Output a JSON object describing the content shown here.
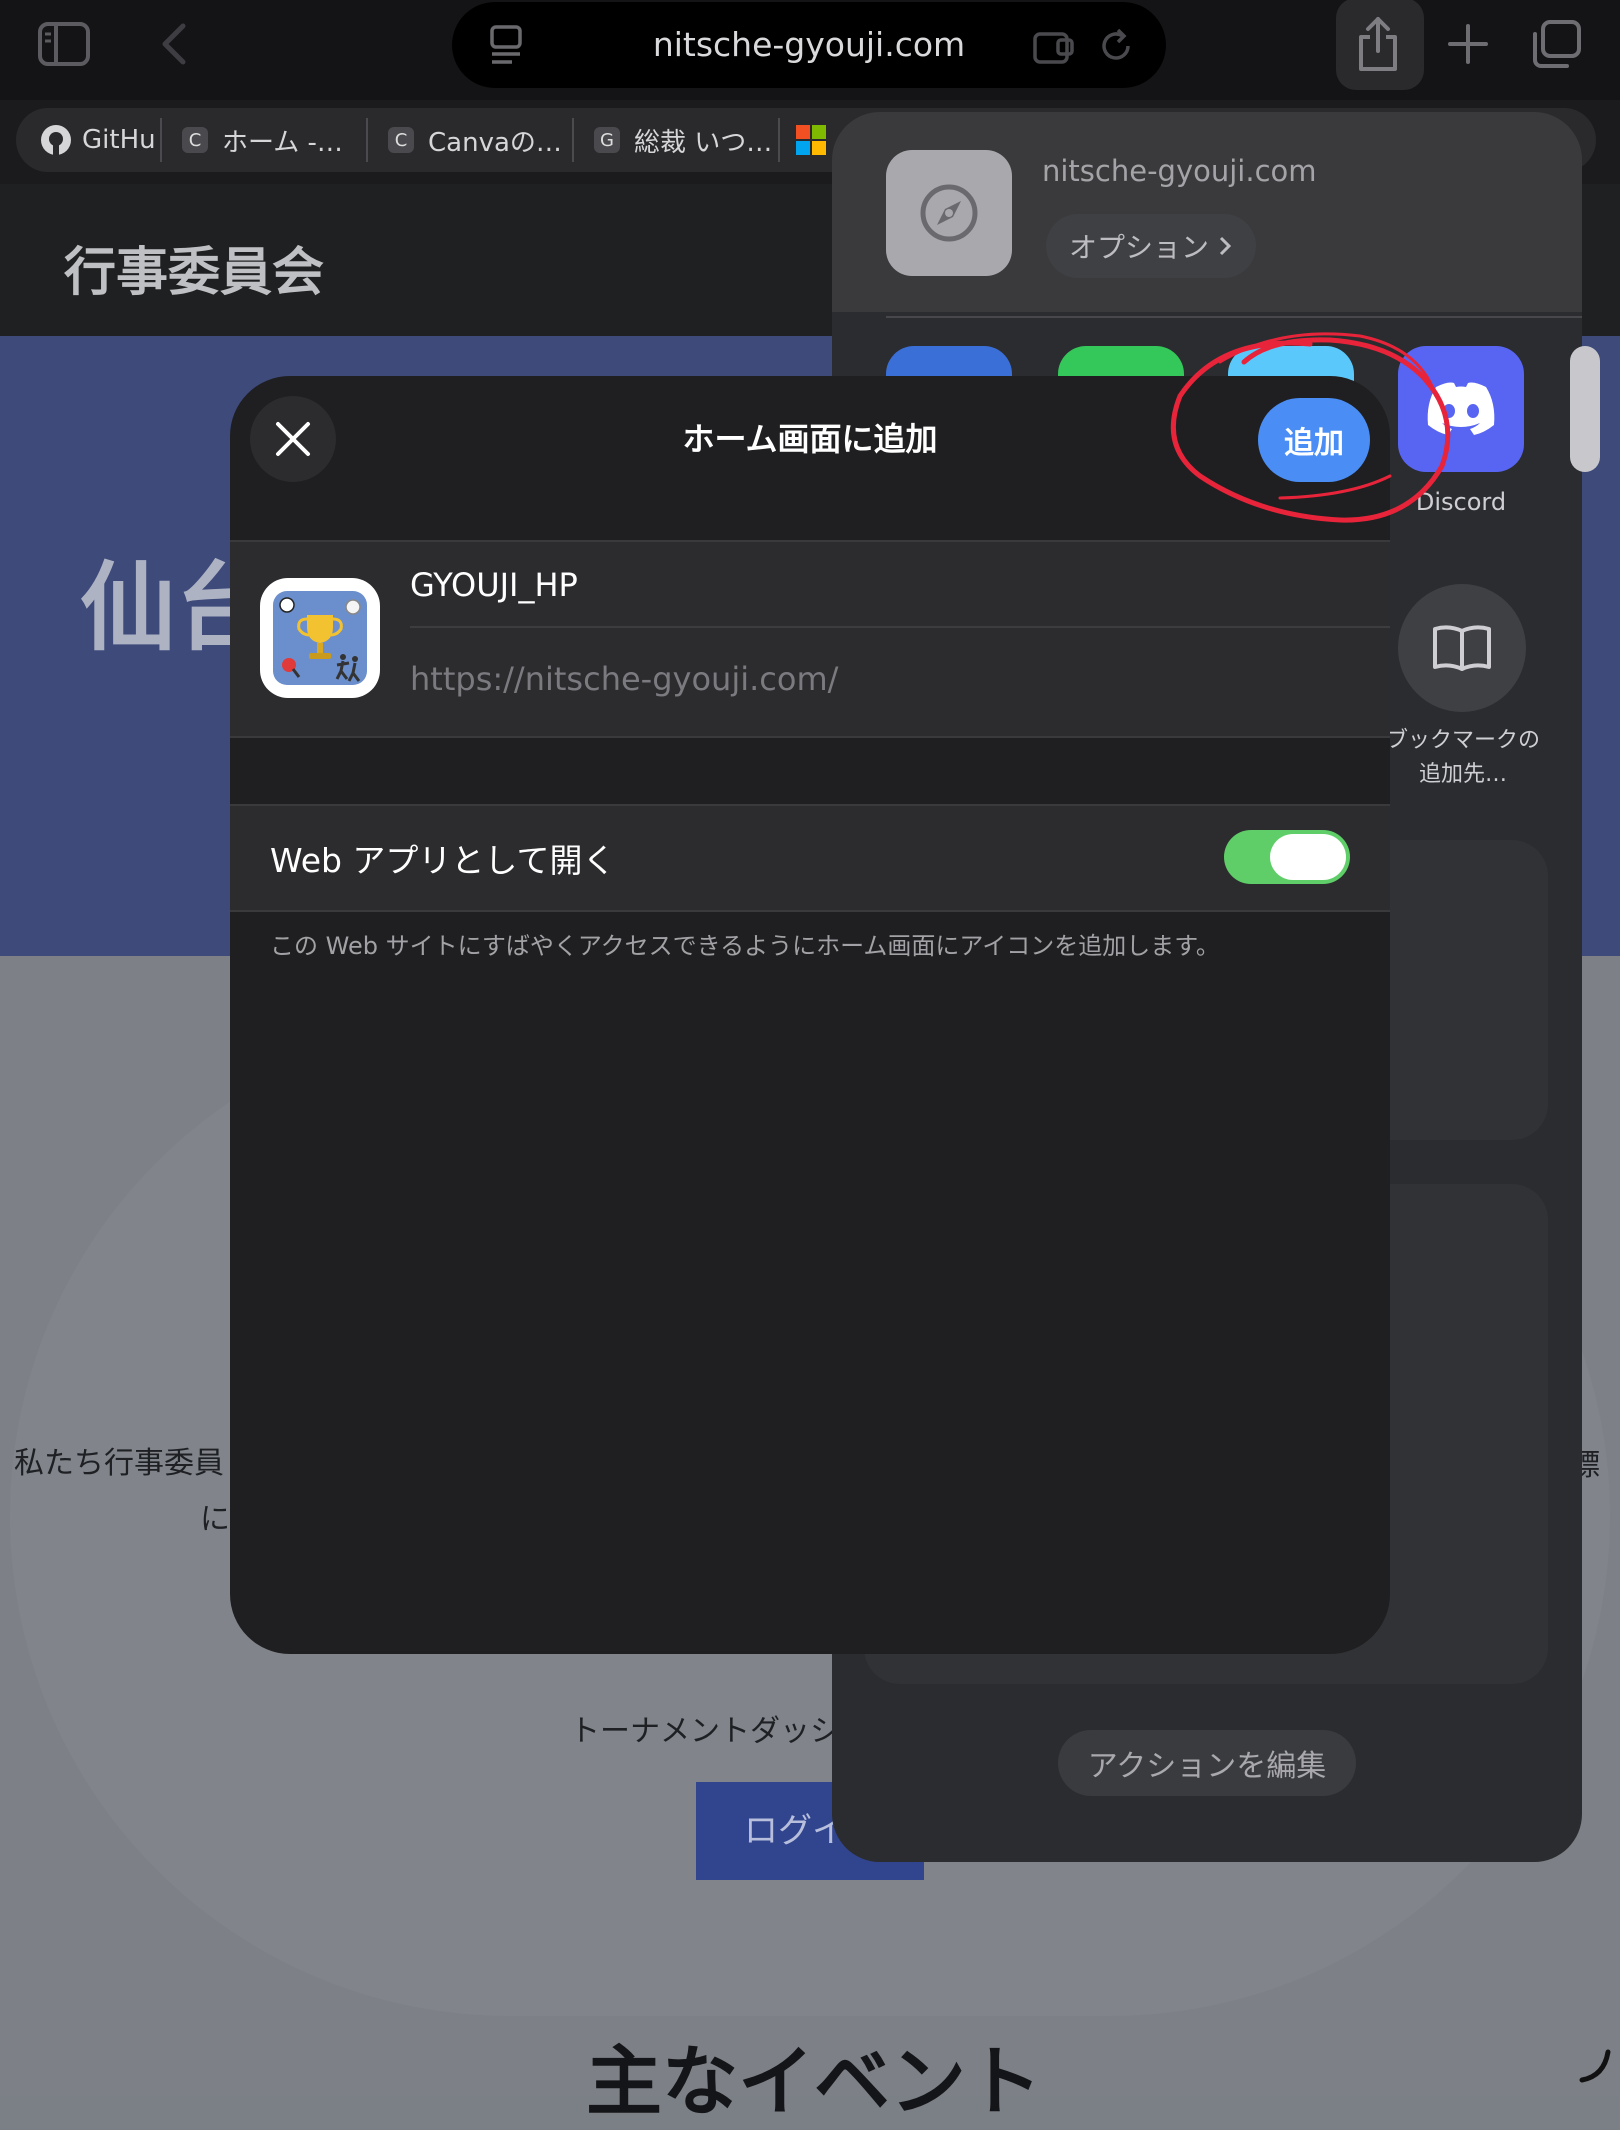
{
  "browser": {
    "address": "nitsche-gyouji.com",
    "tabs": [
      {
        "favicon": "github-icon",
        "label": "GitHu"
      },
      {
        "favicon": "C",
        "label": "ホーム -…"
      },
      {
        "favicon": "C",
        "label": "Canvaの…"
      },
      {
        "favicon": "G",
        "label": "総裁 いつ…"
      },
      {
        "favicon": "microsoft-icon",
        "label": "-"
      },
      {
        "favicon": "",
        "label": "…"
      }
    ]
  },
  "page": {
    "site_title": "行事委員会",
    "hero_heading": "仙台",
    "intro_line1": "私たち行事委員",
    "intro_line2": "に",
    "intro_right": "標",
    "tournament_text": "トーナメントダッシ",
    "login_button": "ログイ",
    "events_heading": "主なイベント"
  },
  "share_sheet": {
    "url": "nitsche-gyouji.com",
    "options_label": "オプション",
    "apps": [
      {
        "name": "",
        "color": "#3a6fd8"
      },
      {
        "name": "",
        "color": "#34c759"
      },
      {
        "name": "",
        "color": "#5ac8fa"
      },
      {
        "name": "Discord",
        "color": "#5865f2"
      }
    ],
    "bookmark_label_line1": "ブックマークの",
    "bookmark_label_line2": "追加先…",
    "edit_actions": "アクションを編集"
  },
  "modal": {
    "title": "ホーム画面に追加",
    "add_button": "追加",
    "app_name": "GYOUJI_HP",
    "url": "https://nitsche-gyouji.com/",
    "webapp_label": "Web アプリとして開く",
    "webapp_enabled": true,
    "footnote": "この Web サイトにすばやくアクセスできるようにホーム画面にアイコンを追加します。"
  },
  "colors": {
    "accent": "#4a8ef5",
    "toggle_on": "#5fce69",
    "annotation": "#e8243a",
    "discord": "#5865f2"
  }
}
